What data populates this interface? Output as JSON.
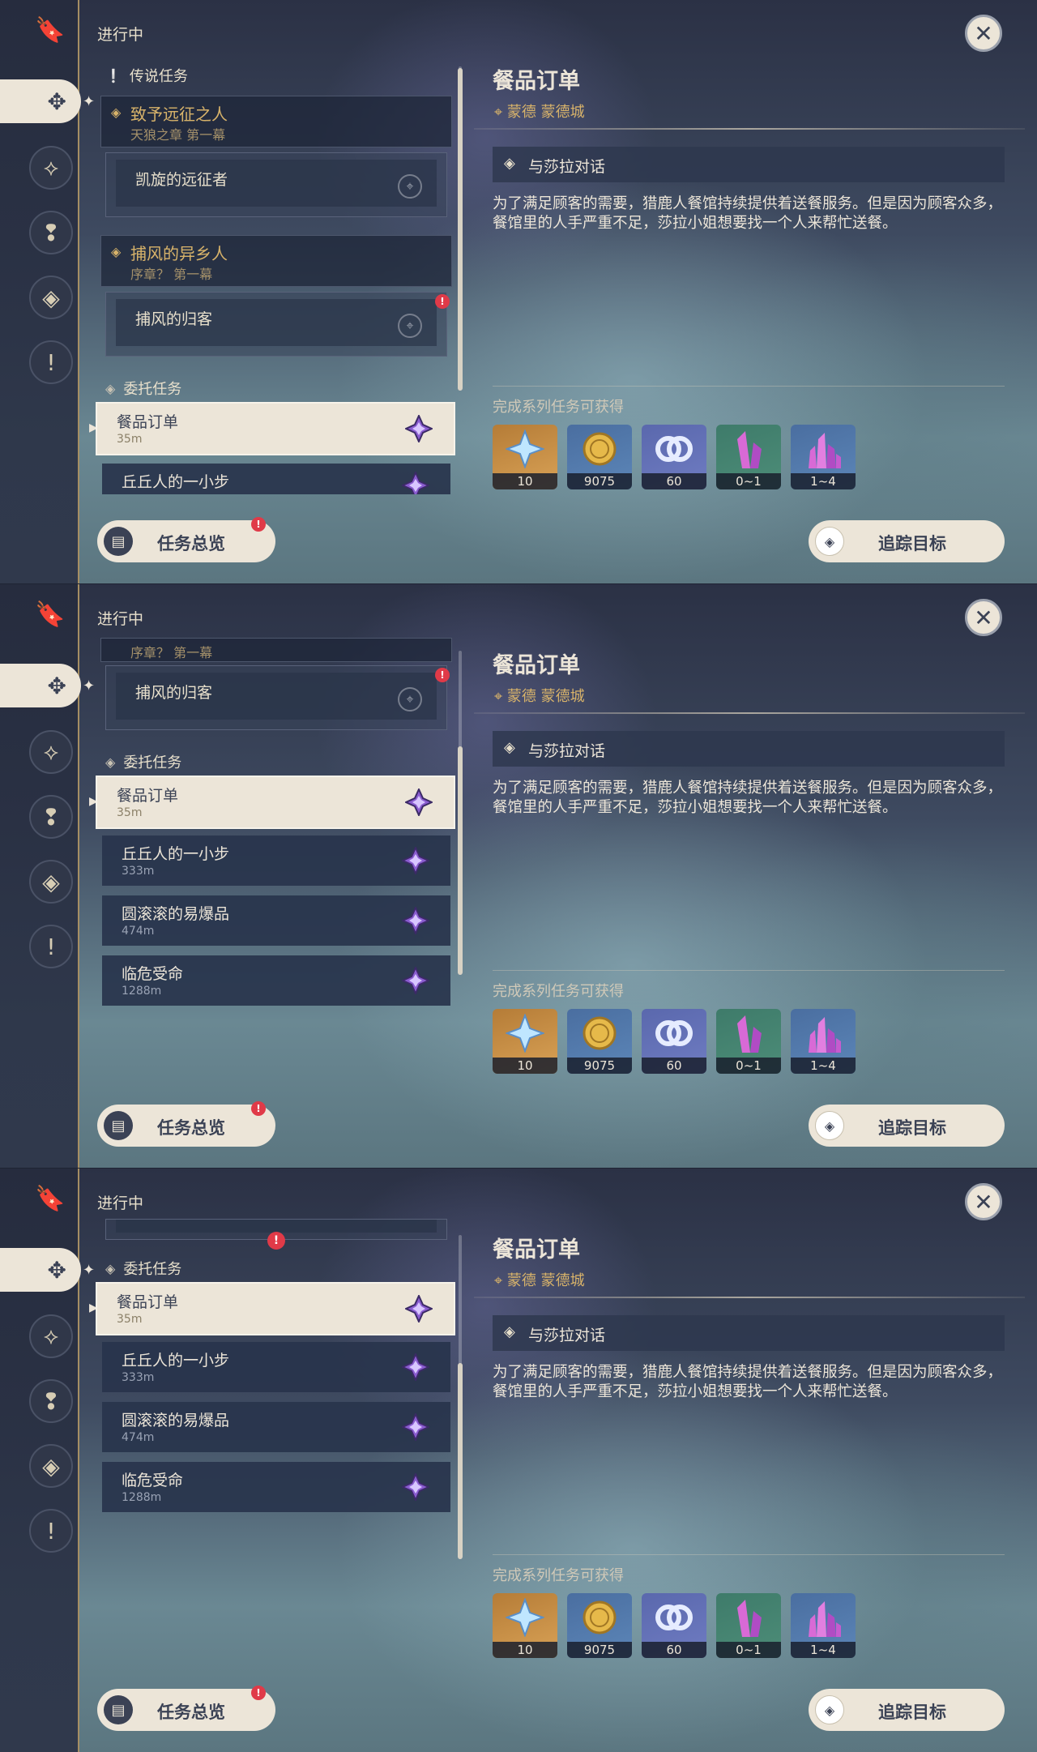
{
  "status_label": "进行中",
  "sections": {
    "legend": "传说任务",
    "commission": "委托任务"
  },
  "legend_quests": [
    {
      "title": "致予远征之人",
      "subtitle": "天狼之章 第一幕",
      "step": "凯旋的远征者",
      "has_alert": false
    },
    {
      "title": "捕风的异乡人",
      "subtitle": "序章？ 第一幕",
      "step": "捕风的归客",
      "has_alert": true
    }
  ],
  "commissions": [
    {
      "name": "餐品订单",
      "distance": "35m",
      "selected": true
    },
    {
      "name": "丘丘人的一小步",
      "distance": "333m",
      "selected": false
    },
    {
      "name": "圆滚滚的易爆品",
      "distance": "474m",
      "selected": false
    },
    {
      "name": "临危受命",
      "distance": "1288m",
      "selected": false
    }
  ],
  "detail": {
    "title": "餐品订单",
    "location": "蒙德 蒙德城",
    "objective": "与莎拉对话",
    "description": "为了满足顾客的需要，猎鹿人餐馆持续提供着送餐服务。但是因为顾客众多，餐馆里的人手严重不足，莎拉小姐想要找一个人来帮忙送餐。",
    "rewards_label": "完成系列任务可获得",
    "rewards": [
      {
        "icon": "primogem-icon",
        "count": "10"
      },
      {
        "icon": "mora-coin-icon",
        "count": "9075"
      },
      {
        "icon": "friendship-exp-icon",
        "count": "60"
      },
      {
        "icon": "crystal-chunk-icon",
        "count": "0~1"
      },
      {
        "icon": "crystal-cluster-icon",
        "count": "1~4"
      }
    ]
  },
  "buttons": {
    "overview": "任务总览",
    "track": "追踪目标"
  },
  "sidebar_icons": [
    "bookmark-icon",
    "commission-icon",
    "legend-quest-icon",
    "archon-quest-icon",
    "world-quest-icon",
    "story-quest-icon"
  ],
  "colors": {
    "accent_gold": "#d8b36a",
    "selected_bg": "#ece5d8",
    "alert_red": "#e03a48"
  }
}
